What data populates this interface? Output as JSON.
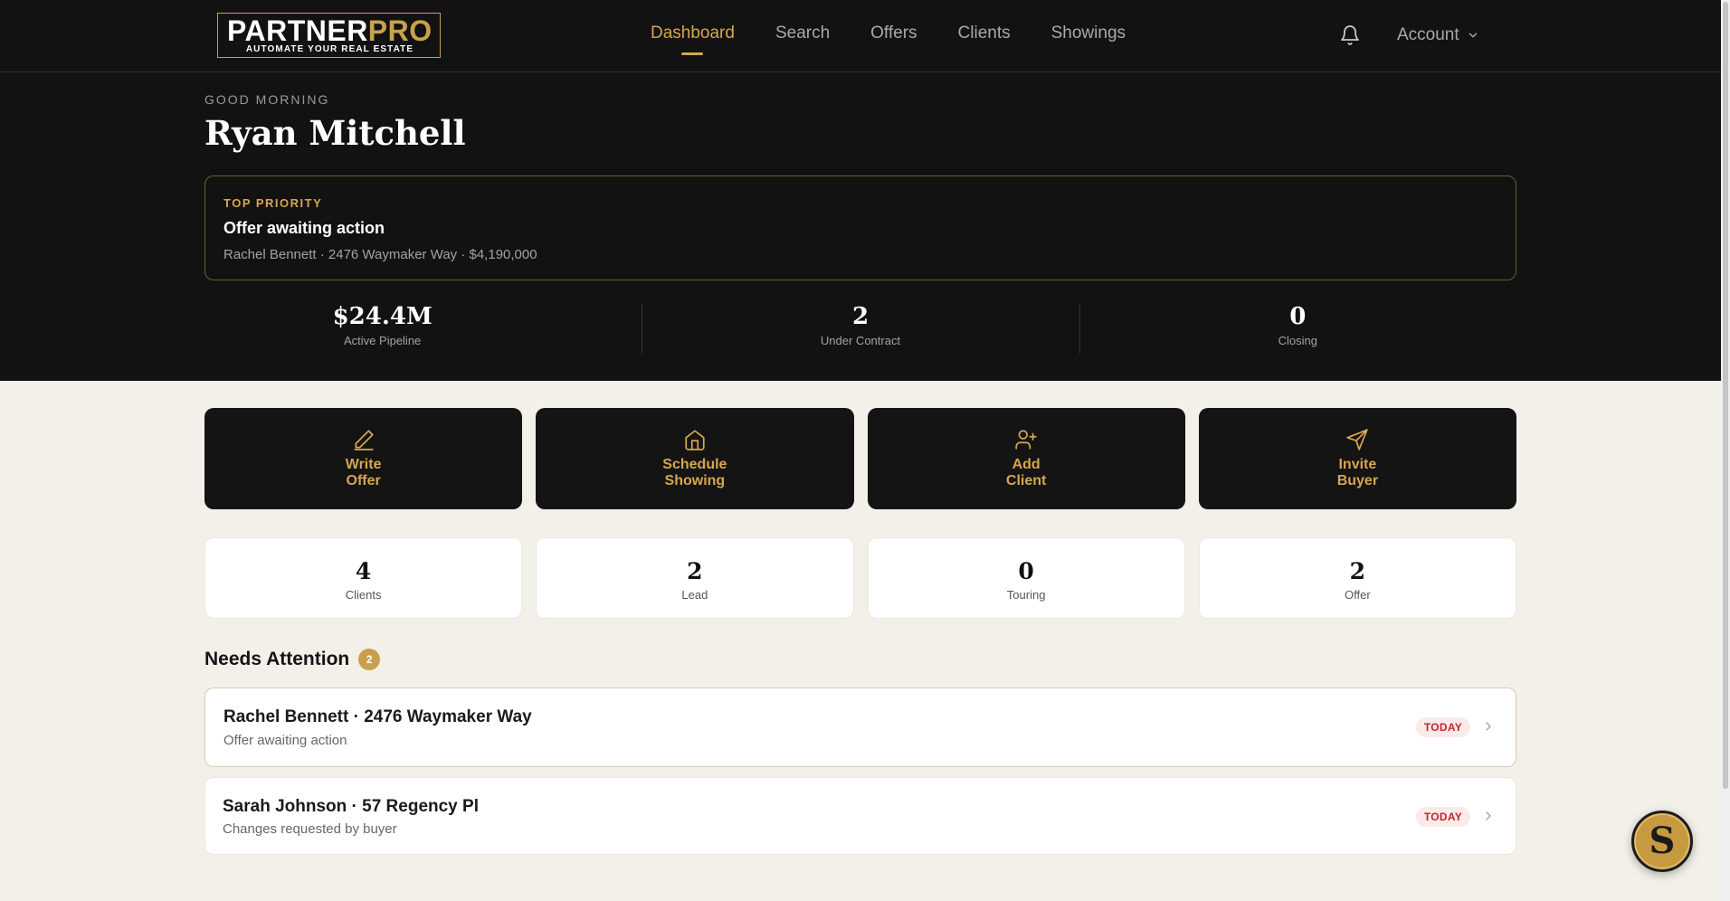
{
  "brand": {
    "name_part1": "PARTNER",
    "name_part2": "PRO",
    "tagline": "AUTOMATE YOUR REAL ESTATE",
    "accent_color": "#d6a650"
  },
  "nav": {
    "items": [
      {
        "label": "Dashboard",
        "active": true
      },
      {
        "label": "Search",
        "active": false
      },
      {
        "label": "Offers",
        "active": false
      },
      {
        "label": "Clients",
        "active": false
      },
      {
        "label": "Showings",
        "active": false
      }
    ],
    "account_label": "Account",
    "notification_icon": "bell-icon"
  },
  "hero": {
    "greeting": "GOOD MORNING",
    "name": "Ryan Mitchell"
  },
  "priority": {
    "label": "TOP PRIORITY",
    "title": "Offer awaiting action",
    "details": "Rachel Bennett · 2476 Waymaker Way · $4,190,000"
  },
  "stats": [
    {
      "value": "$24.4M",
      "label": "Active Pipeline"
    },
    {
      "value": "2",
      "label": "Under Contract"
    },
    {
      "value": "0",
      "label": "Closing"
    }
  ],
  "actions": [
    {
      "label": "Write\nOffer",
      "icon": "pencil-icon"
    },
    {
      "label": "Schedule\nShowing",
      "icon": "home-icon"
    },
    {
      "label": "Add\nClient",
      "icon": "add-user-icon"
    },
    {
      "label": "Invite\nBuyer",
      "icon": "send-icon"
    }
  ],
  "counters": [
    {
      "value": "4",
      "label": "Clients"
    },
    {
      "value": "2",
      "label": "Lead"
    },
    {
      "value": "0",
      "label": "Touring"
    },
    {
      "value": "2",
      "label": "Offer"
    }
  ],
  "needs_attention": {
    "title": "Needs Attention",
    "count": "2",
    "items": [
      {
        "title": "Rachel Bennett · 2476 Waymaker Way",
        "subtitle": "Offer awaiting action",
        "badge": "TODAY"
      },
      {
        "title": "Sarah Johnson · 57 Regency Pl",
        "subtitle": "Changes requested by buyer",
        "badge": "TODAY"
      }
    ]
  },
  "assistant": {
    "initial": "S"
  }
}
